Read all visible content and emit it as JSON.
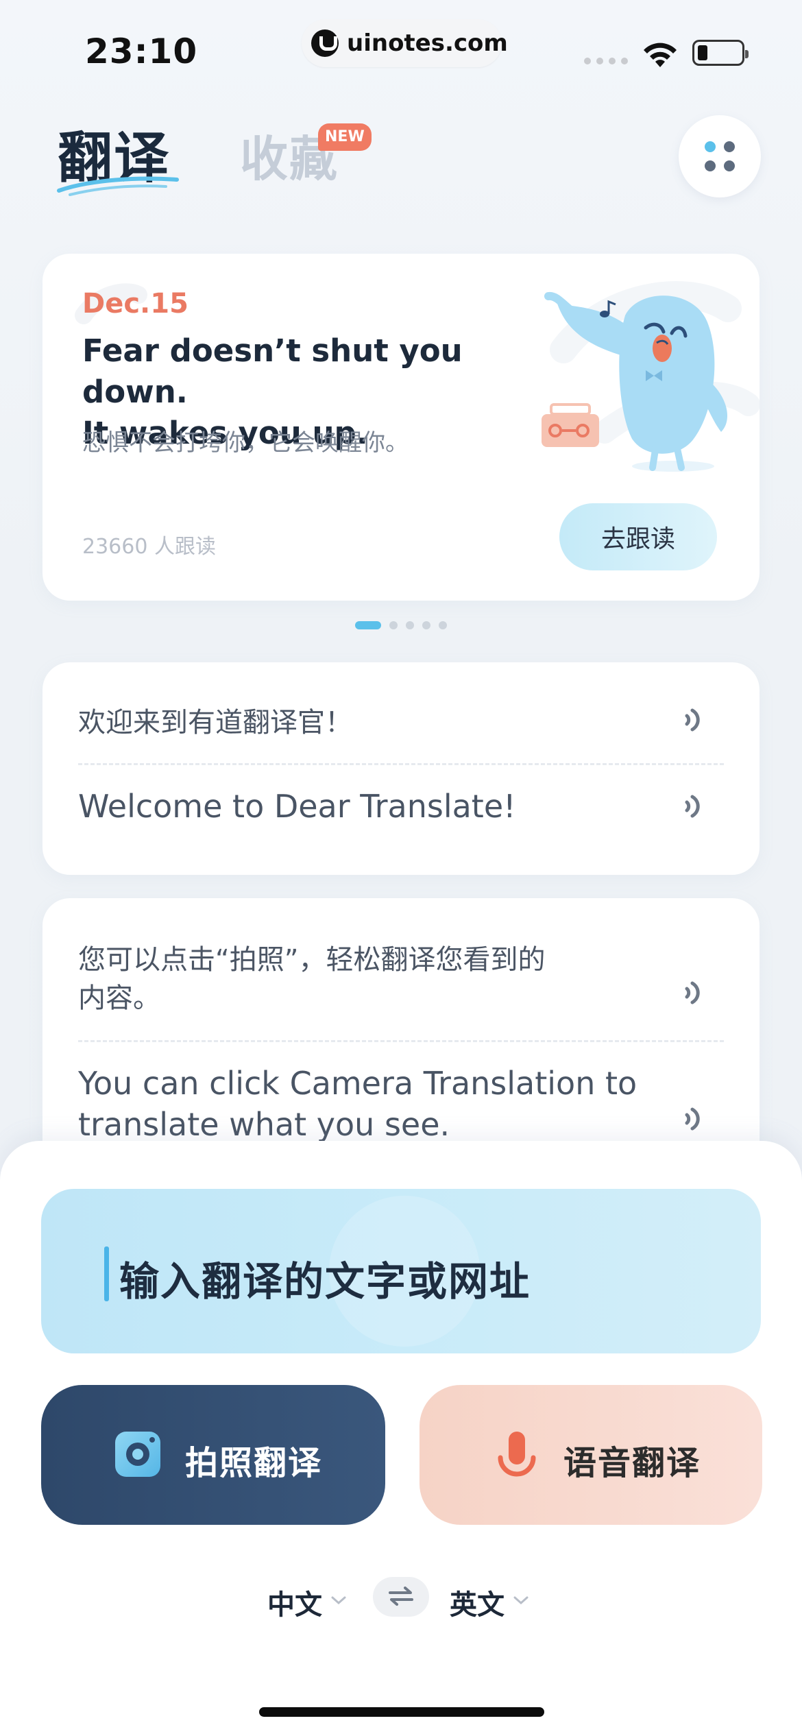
{
  "status_bar": {
    "time": "23:10",
    "url": "uinotes.com"
  },
  "header": {
    "tab_translate": "翻译",
    "tab_favorites": "收藏",
    "new_badge": "NEW"
  },
  "daily": {
    "date": "Dec.15",
    "sentence_en_line1": "Fear doesn’t shut you down.",
    "sentence_en_line2": "It wakes you up.",
    "sentence_cn": "恐惧不会打垮你，它会唤醒你。",
    "follower_count": "23660 人跟读",
    "follow_button": "去跟读",
    "pager": {
      "total": 5,
      "active_index": 0
    }
  },
  "conversation": [
    {
      "cn": "欢迎来到有道翻译官！",
      "en": "Welcome to Dear Translate!"
    },
    {
      "cn": "您可以点击“拍照”，轻松翻译您看到的内容。",
      "cn_line1": "您可以点击“拍照”，轻松翻译您看到的",
      "cn_line2": "内容。",
      "en": "You can click Camera Translation to translate what you see.",
      "en_line1": "You can click Camera Translation to",
      "en_line2": "translate what you see."
    }
  ],
  "input": {
    "placeholder": "输入翻译的文字或网址"
  },
  "actions": {
    "camera_label": "拍照翻译",
    "voice_label": "语音翻译"
  },
  "languages": {
    "source": "中文",
    "target": "英文"
  },
  "colors": {
    "accent_blue": "#5bc0ea",
    "date_orange": "#ea7a63",
    "camera_button": "#3a577c",
    "voice_button": "#f6d3c6",
    "mic_red": "#ec6a4f"
  },
  "icons": {
    "menu": "grid-dots-icon",
    "speaker": "speaker-wave-icon",
    "camera": "camera-icon",
    "mic": "microphone-icon",
    "swap": "swap-arrows-icon"
  }
}
